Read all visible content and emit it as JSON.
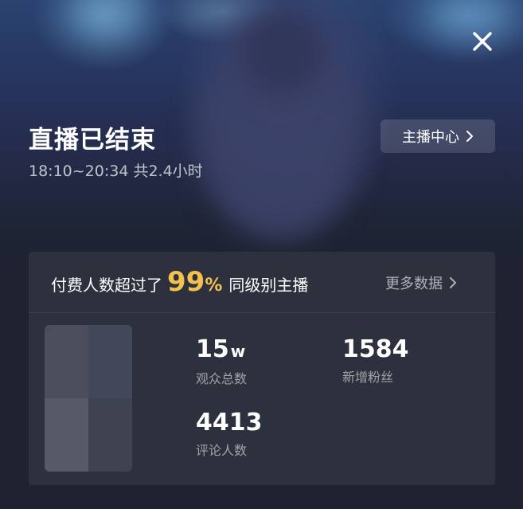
{
  "hero": {
    "title": "直播已结束",
    "time_range": "18:10~20:34 共2.4小时",
    "host_center_label": "主播中心"
  },
  "summary": {
    "prefix": "付费人数超过了",
    "percent_value": "99",
    "percent_sign": "%",
    "suffix": "同级别主播",
    "more_label": "更多数据"
  },
  "stats": {
    "viewers": {
      "value": "15",
      "unit": "w",
      "label": "观众总数"
    },
    "new_fans": {
      "value": "1584",
      "label": "新增粉丝"
    },
    "comments": {
      "value": "4413",
      "label": "评论人数"
    }
  },
  "colors": {
    "accent_gold": "#f2c14e",
    "card_bg": "#2d303d",
    "page_bg": "#1e2231"
  },
  "icons": {
    "close": "close-icon",
    "chevron": "chevron-right-icon",
    "thumbnail": "blurred-avatar-thumbnail"
  }
}
